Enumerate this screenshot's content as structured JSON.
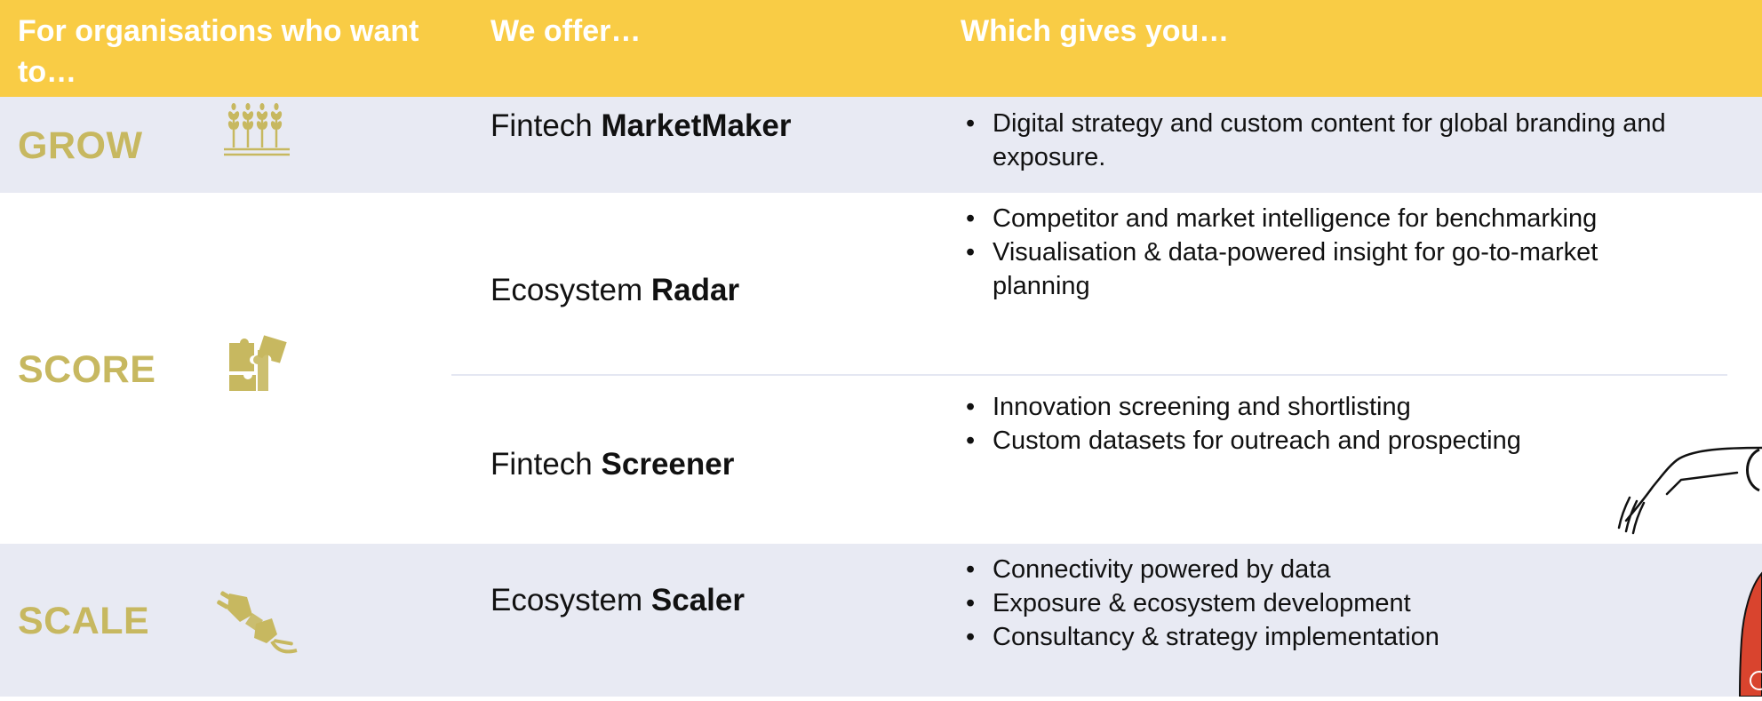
{
  "header": {
    "col1": "For organisations who want to…",
    "col2": "We offer…",
    "col3": "Which gives you…"
  },
  "rows": [
    {
      "goal": "GROW",
      "icon": "wheat-icon",
      "offerings": [
        {
          "prefix": "Fintech",
          "name": "MarketMaker",
          "benefits": [
            "Digital strategy and custom content for global branding and exposure."
          ]
        }
      ]
    },
    {
      "goal": "SCORE",
      "icon": "puzzle-icon",
      "offerings": [
        {
          "prefix": "Ecosystem",
          "name": "Radar",
          "benefits": [
            "Competitor and market intelligence for benchmarking",
            "Visualisation & data-powered insight for go-to-market planning"
          ]
        },
        {
          "prefix": "Fintech",
          "name": "Screener",
          "benefits": [
            "Innovation screening and shortlisting",
            "Custom datasets for outreach and prospecting"
          ]
        }
      ]
    },
    {
      "goal": "SCALE",
      "icon": "plug-icon",
      "offerings": [
        {
          "prefix": "Ecosystem",
          "name": "Scaler",
          "benefits": [
            "Connectivity powered by data",
            "Exposure & ecosystem development",
            "Consultancy & strategy implementation"
          ]
        }
      ]
    }
  ],
  "colors": {
    "header_bg": "#f9cc45",
    "band_grey": "#e8eaf3",
    "goal_text": "#c7b860",
    "decoration_red": "#d9442e"
  }
}
